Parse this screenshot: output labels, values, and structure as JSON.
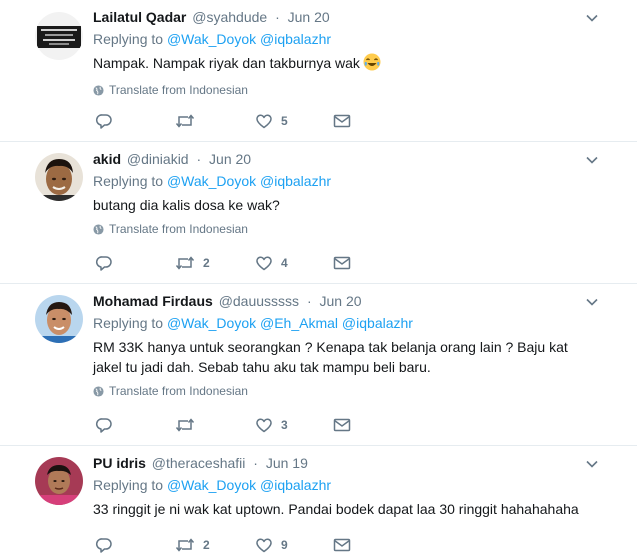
{
  "tweets": [
    {
      "fullname": "Lailatul Qadar",
      "username": "@syahdude",
      "time": "Jun 20",
      "replying_prefix": "Replying to",
      "mentions": [
        "@Wak_Doyok",
        "@iqbalazhr"
      ],
      "text_lines": [
        "Nampak. Nampak riyak dan takburnya wak"
      ],
      "emoji": "joy-emoji",
      "translate": "Translate from Indonesian",
      "reply_count": "",
      "retweet_count": "",
      "like_count": "5"
    },
    {
      "fullname": "akid",
      "username": "@diniakid",
      "time": "Jun 20",
      "replying_prefix": "Replying to",
      "mentions": [
        "@Wak_Doyok",
        "@iqbalazhr"
      ],
      "text_lines": [
        "butang dia kalis dosa ke wak?"
      ],
      "translate": "Translate from Indonesian",
      "reply_count": "",
      "retweet_count": "2",
      "like_count": "4"
    },
    {
      "fullname": "Mohamad Firdaus",
      "username": "@dauusssss",
      "time": "Jun 20",
      "replying_prefix": "Replying to",
      "mentions": [
        "@Wak_Doyok",
        "@Eh_Akmal",
        "@iqbalazhr"
      ],
      "text_lines": [
        "RM 33K hanya untuk seorangkan ? Kenapa tak belanja orang lain ? Baju kat",
        "jakel tu jadi dah. Sebab tahu aku tak mampu beli baru."
      ],
      "translate": "Translate from Indonesian",
      "reply_count": "",
      "retweet_count": "",
      "like_count": "3"
    },
    {
      "fullname": "PU idris",
      "username": "@theraceshafii",
      "time": "Jun 19",
      "replying_prefix": "Replying to",
      "mentions": [
        "@Wak_Doyok",
        "@iqbalazhr"
      ],
      "text_lines": [
        "33 ringgit je ni wak kat uptown. Pandai bodek dapat laa 30 ringgit hahahahaha"
      ],
      "reply_count": "",
      "retweet_count": "2",
      "like_count": "9"
    }
  ],
  "colors": {
    "link": "#1da1f2",
    "secondary": "#657786",
    "text": "#14171a",
    "divider": "#e6ecf0"
  },
  "icons": [
    "caret-down-icon",
    "globe-icon",
    "reply-icon",
    "retweet-icon",
    "heart-icon",
    "message-icon"
  ]
}
